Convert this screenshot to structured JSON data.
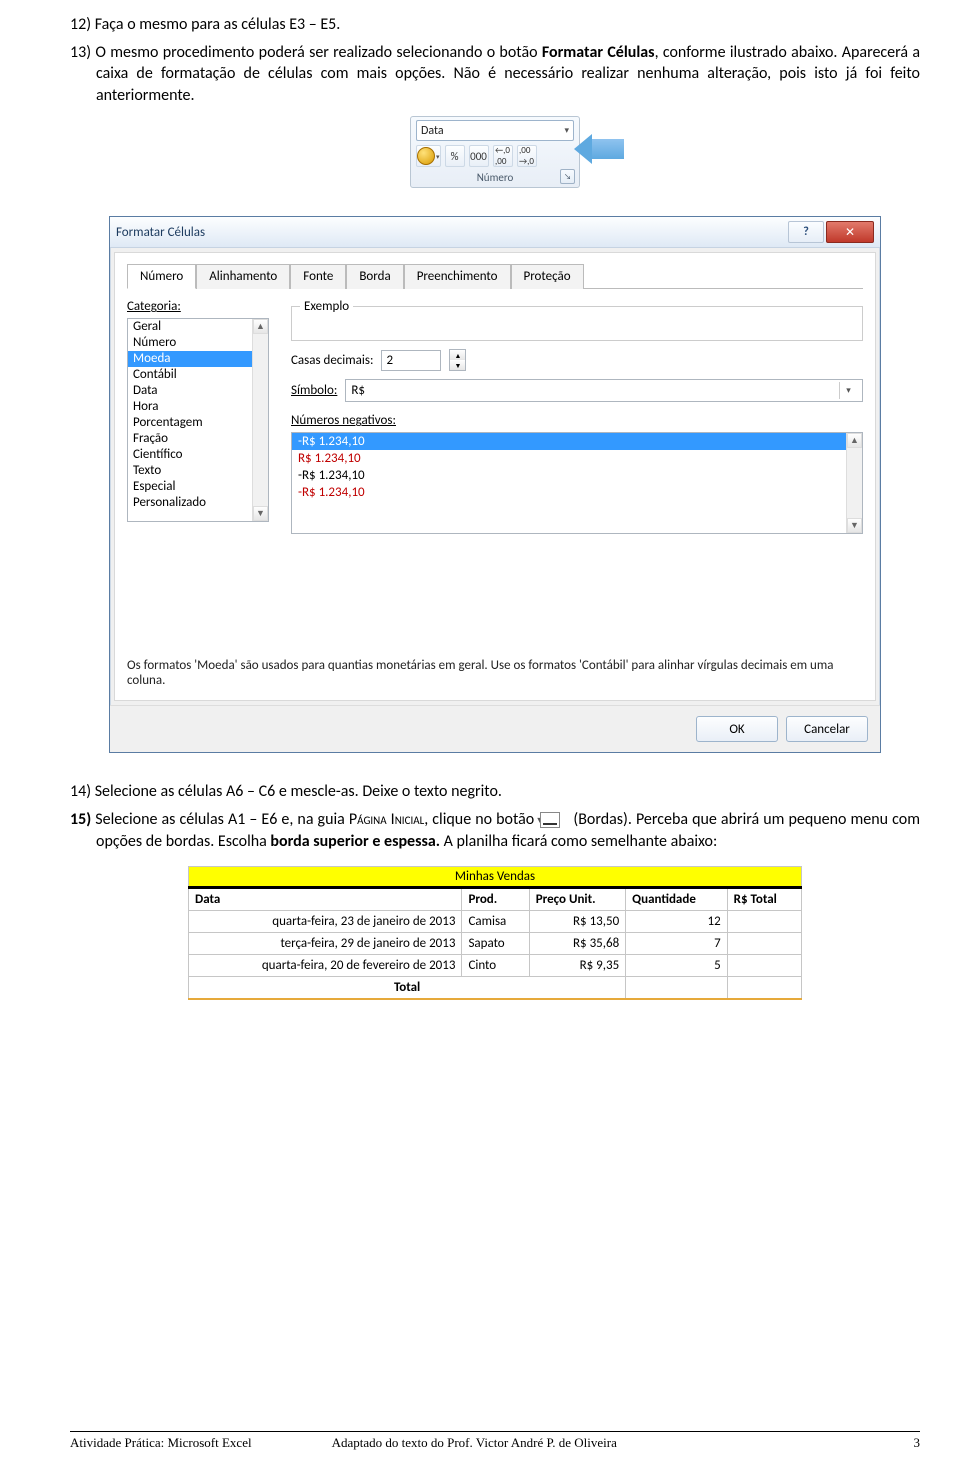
{
  "paragraphs": {
    "p12": "12) Faça o mesmo para as células E3 – E5.",
    "p13_a": "13) O mesmo procedimento poderá ser realizado selecionando o botão ",
    "p13_bold": "Formatar Células",
    "p13_b": ", conforme ilustrado abaixo. Aparecerá a caixa de formatação de células com mais opções. Não é necessário realizar nenhuma alteração, pois isto já foi feito anteriormente."
  },
  "ribbon": {
    "format": "Data",
    "percent": "%",
    "thousand": "000",
    "inc": ",0 ,00",
    "dec": ",00 ,0",
    "group": "Número"
  },
  "dialog": {
    "title": "Formatar Células",
    "tabs": [
      "Número",
      "Alinhamento",
      "Fonte",
      "Borda",
      "Preenchimento",
      "Proteção"
    ],
    "category_label": "Categoria:",
    "categories": [
      "Geral",
      "Número",
      "Moeda",
      "Contábil",
      "Data",
      "Hora",
      "Porcentagem",
      "Fração",
      "Científico",
      "Texto",
      "Especial",
      "Personalizado"
    ],
    "selected_category_index": 2,
    "example_label": "Exemplo",
    "decimals_label": "Casas decimais:",
    "decimals_value": "2",
    "symbol_label": "Símbolo:",
    "symbol_value": "R$",
    "negatives_label": "Números negativos:",
    "negatives": [
      {
        "text": "-R$ 1.234,10",
        "red": false,
        "sel": true
      },
      {
        "text": "R$ 1.234,10",
        "red": true,
        "sel": false
      },
      {
        "text": "-R$ 1.234,10",
        "red": false,
        "sel": false
      },
      {
        "text": "-R$ 1.234,10",
        "red": true,
        "sel": false
      }
    ],
    "hint": "Os formatos 'Moeda' são usados para quantias monetárias em geral. Use os formatos 'Contábil' para alinhar vírgulas decimais em uma coluna.",
    "ok": "OK",
    "cancel": "Cancelar",
    "help": "?",
    "close": "✕"
  },
  "paragraphs2": {
    "p14": "14) Selecione as células A6 – C6 e mescle-as. Deixe o texto negrito.",
    "p15_a": "15) Selecione as células A1 – E6 e, na guia ",
    "p15_smallcaps": "Página Inicial",
    "p15_b": ", clique no botão ",
    "p15_c": " (Bordas). Perceba que abrirá um pequeno menu com opções de bordas. Escolha ",
    "p15_bold": "borda superior e espessa.",
    "p15_d": " A planilha ficará como semelhante abaixo:"
  },
  "sheet": {
    "title": "Minhas Vendas",
    "headers": [
      "Data",
      "Prod.",
      "Preço Unit.",
      "Quantidade",
      "R$ Total"
    ],
    "rows": [
      {
        "data": "quarta-feira, 23 de janeiro de 2013",
        "prod": "Camisa",
        "preco": "R$ 13,50",
        "qtd": "12",
        "tot": ""
      },
      {
        "data": "terça-feira, 29 de janeiro de 2013",
        "prod": "Sapato",
        "preco": "R$ 35,68",
        "qtd": "7",
        "tot": ""
      },
      {
        "data": "quarta-feira, 20 de fevereiro de 2013",
        "prod": "Cinto",
        "preco": "R$ 9,35",
        "qtd": "5",
        "tot": ""
      }
    ],
    "total_label": "Total"
  },
  "footer": {
    "left": "Atividade Prática: Microsoft Excel",
    "mid": "Adaptado do texto do Prof. Victor André P. de Oliveira",
    "right": "3"
  }
}
